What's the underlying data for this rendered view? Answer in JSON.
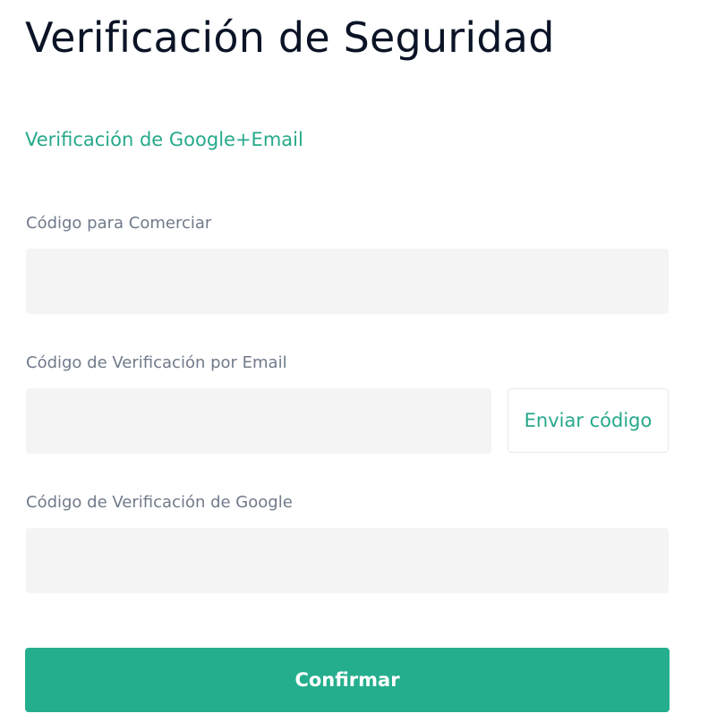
{
  "page": {
    "title": "Verificación de Seguridad",
    "method_link": "Verificación de Google+Email"
  },
  "fields": [
    {
      "label": "Código para Comerciar",
      "value": "",
      "placeholder": ""
    },
    {
      "label": "Código de Verificación por Email",
      "value": "",
      "placeholder": ""
    },
    {
      "label": "Código de Verificación de Google",
      "value": "",
      "placeholder": ""
    }
  ],
  "buttons": {
    "send_code": "Enviar código",
    "confirm": "Confirmar"
  },
  "colors": {
    "accent": "#26a98b",
    "primary_button": "#24ae8d",
    "input_background": "#f4f4f4",
    "title_text": "#0b1426",
    "label_text": "#707a8a"
  }
}
